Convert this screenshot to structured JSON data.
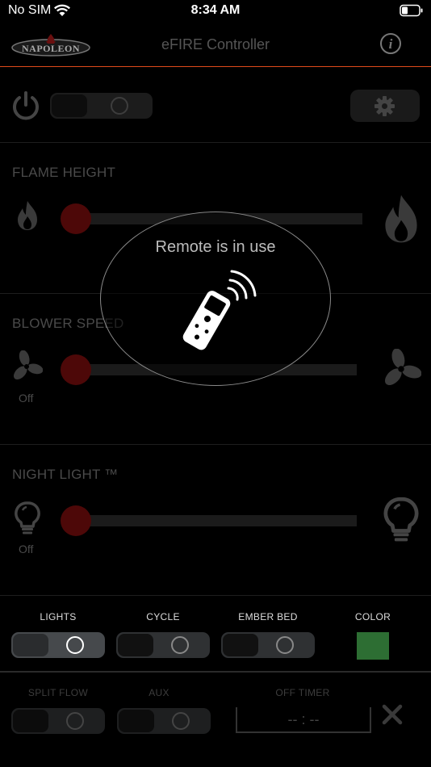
{
  "status_bar": {
    "carrier": "No SIM",
    "time": "8:34 AM"
  },
  "nav": {
    "logo_text": "NAPOLEON",
    "title": "eFIRE Controller"
  },
  "sections": {
    "flame_height": {
      "label": "FLAME HEIGHT",
      "value": 0
    },
    "blower_speed": {
      "label": "BLOWER SPEED",
      "value": 0,
      "state": "Off"
    },
    "night_light": {
      "label": "NIGHT LIGHT ™",
      "value": 0,
      "state": "Off"
    }
  },
  "toggles": {
    "lights": {
      "label": "LIGHTS",
      "on": true
    },
    "cycle": {
      "label": "CYCLE",
      "on": false
    },
    "ember_bed": {
      "label": "EMBER BED",
      "on": false
    },
    "color": {
      "label": "COLOR",
      "swatch": "#2d6e33"
    },
    "split_flow": {
      "label": "SPLIT FLOW",
      "on": false
    },
    "aux": {
      "label": "AUX",
      "on": false
    }
  },
  "off_timer": {
    "label": "OFF TIMER",
    "value": "-- : --"
  },
  "overlay": {
    "message": "Remote is in use"
  },
  "colors": {
    "accent": "#e04a1a",
    "thumb": "#4d0808"
  }
}
